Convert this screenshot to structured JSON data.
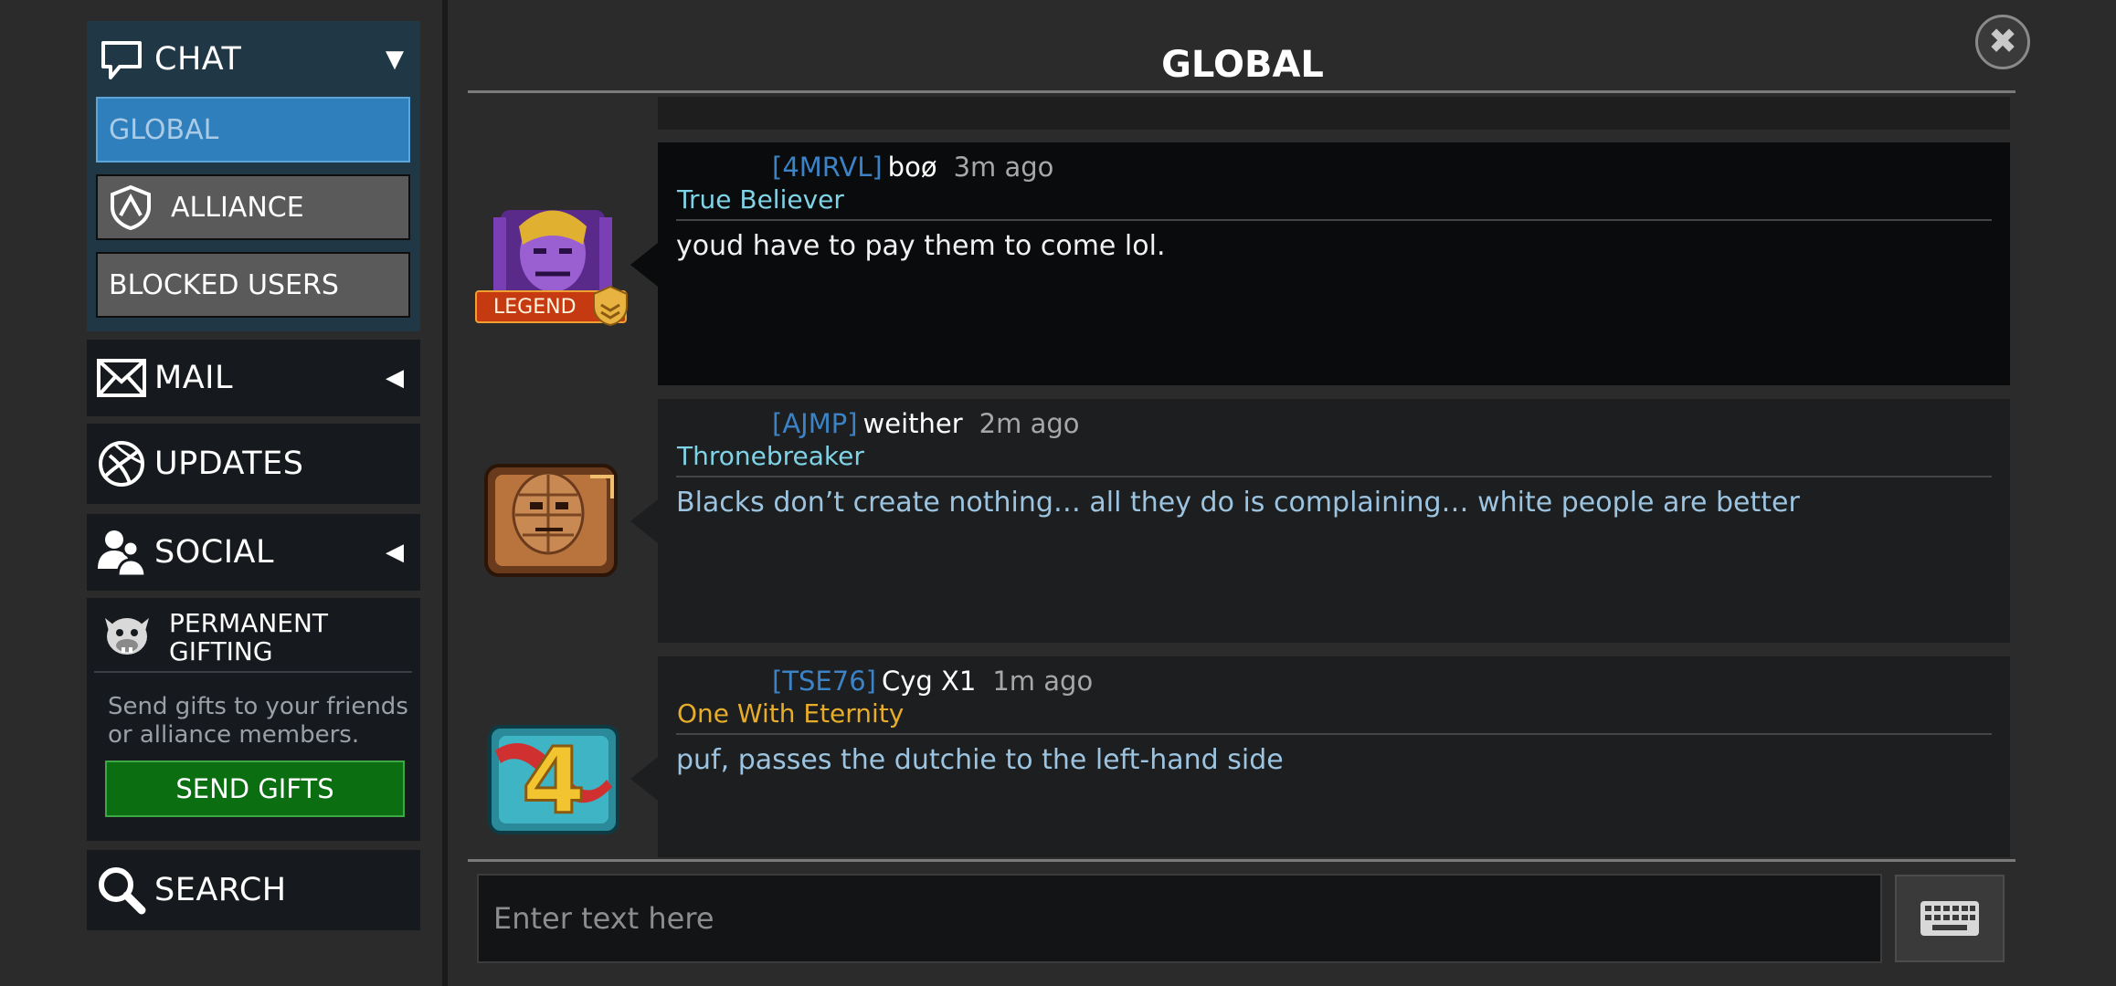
{
  "sidebar": {
    "chat": {
      "label": "CHAT",
      "arrow": "▼",
      "icon": "chat-bubble-icon"
    },
    "chat_tabs": {
      "global": "GLOBAL",
      "alliance": "ALLIANCE",
      "blocked": "BLOCKED USERS"
    },
    "mail": {
      "label": "MAIL",
      "arrow": "◀",
      "icon": "envelope-icon"
    },
    "updates": {
      "label": "UPDATES",
      "icon": "globe-icon"
    },
    "social": {
      "label": "SOCIAL",
      "arrow": "◀",
      "icon": "people-icon"
    },
    "gifting": {
      "title_line1": "PERMANENT",
      "title_line2": "GIFTING",
      "description": "Send gifts to your friends or alliance members.",
      "button": "SEND GIFTS",
      "icon": "bulldog-icon"
    },
    "search": {
      "label": "SEARCH",
      "icon": "magnifier-icon"
    }
  },
  "main": {
    "title": "GLOBAL",
    "close": "✖",
    "messages": [
      {
        "tag": "[4MRVL]",
        "name": "boø",
        "time": "3m ago",
        "rank": "True Believer",
        "text": "youd have to pay them to come lol.",
        "badge": "LEGEND",
        "avatar_icon": "thanos-portrait-icon"
      },
      {
        "tag": "[AJMP]",
        "name": "weither",
        "time": "2m ago",
        "rank": "Thronebreaker",
        "text": "Blacks don’t create nothing… all they do is complaining… white people are better",
        "avatar_icon": "thing-portrait-icon"
      },
      {
        "tag": "[TSE76]",
        "name": "Cyg X1",
        "time": "1m ago",
        "rank": "One With Eternity",
        "text": "puf, passes the dutchie to the left-hand side",
        "avatar_icon": "anniversary-4-icon"
      }
    ],
    "input": {
      "placeholder": "Enter text here"
    },
    "keyboard_icon": "keyboard-icon"
  },
  "colors": {
    "accent_blue": "#2f7fbd",
    "tag_blue": "#3b83c6",
    "rank_cyan": "#7fd3e6",
    "rank_gold": "#e7ad2a",
    "gift_green": "#0b6e11"
  }
}
